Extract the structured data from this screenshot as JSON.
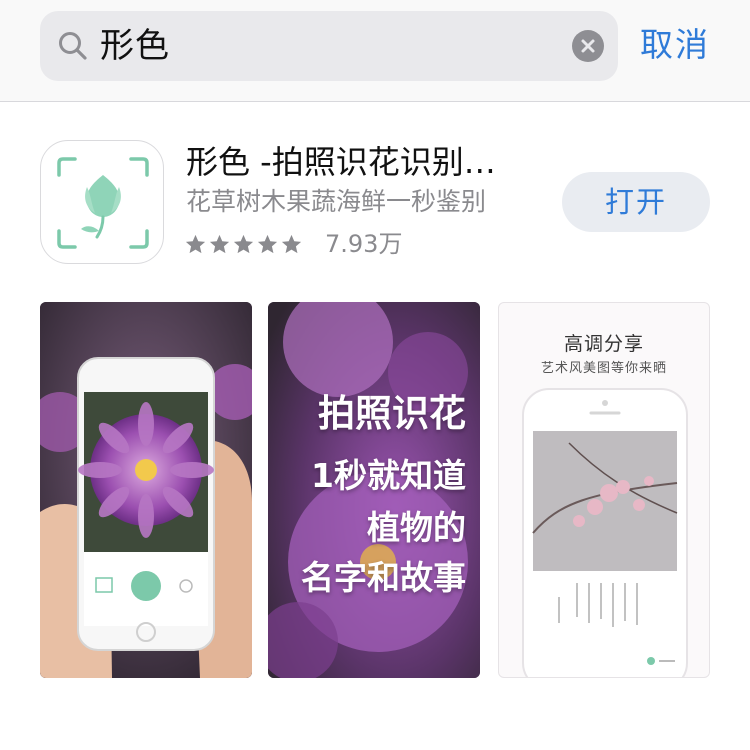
{
  "search": {
    "query": "形色",
    "cancel_label": "取消"
  },
  "app": {
    "title": "形色 -拍照识花识别…",
    "subtitle": "花草树木果蔬海鲜一秒鉴别",
    "rating_stars": 5,
    "rating_count": "7.93万",
    "open_label": "打开",
    "accent_color": "#2f7bd8",
    "icon_color": "#7cc9aa"
  },
  "screenshots": [
    {
      "name": "camera-preview"
    },
    {
      "lines": [
        "拍照识花",
        "1秒就知道",
        "植物的",
        "名字和故事"
      ]
    },
    {
      "title": "高调分享",
      "subtitle": "艺术风美图等你来晒"
    }
  ],
  "icons": [
    "search-icon",
    "clear-icon",
    "star-icon",
    "flower-logo-icon"
  ]
}
